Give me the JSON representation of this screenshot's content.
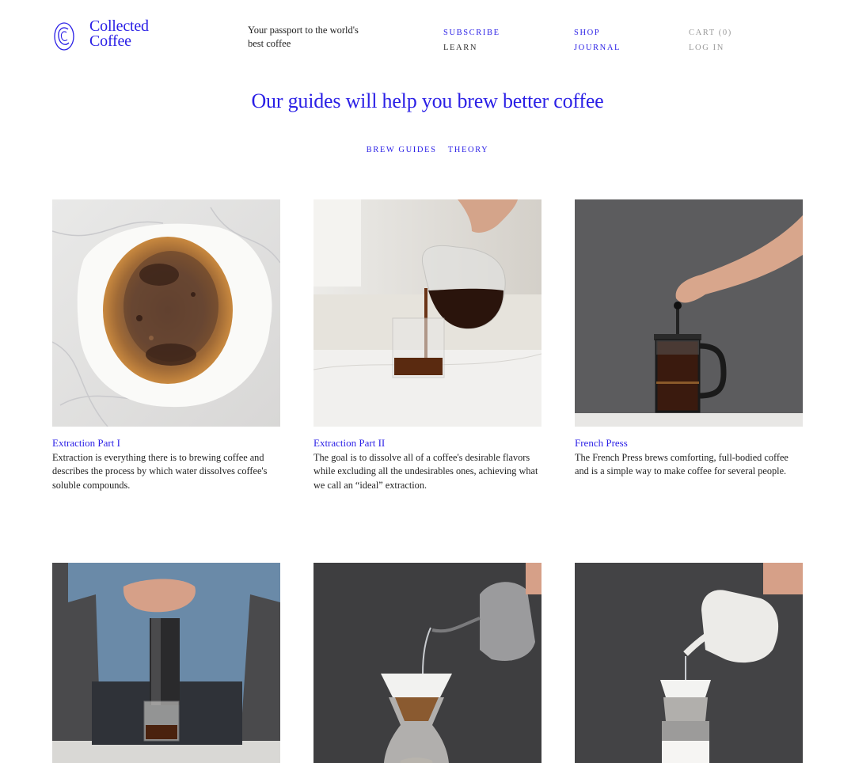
{
  "brand": {
    "name_line1": "Collected",
    "name_line2": "Coffee",
    "tagline": "Your passport to the world's best coffee"
  },
  "nav": {
    "subscribe": "SUBSCRIBE",
    "learn": "LEARN",
    "shop": "SHOP",
    "journal": "JOURNAL",
    "cart": "CART (0)",
    "login": "LOG IN"
  },
  "hero": {
    "title": "Our guides will help you brew better coffee"
  },
  "filters": [
    "BREW GUIDES",
    "THEORY"
  ],
  "guides": [
    {
      "title": "Extraction Part I",
      "description": "Extraction is everything there is to brewing coffee and describes the process by which water dissolves coffee's soluble compounds.",
      "image": "coffee-filter-grounds-photo"
    },
    {
      "title": "Extraction Part II",
      "description": "The goal is to dissolve all of a coffee's desirable flavors while excluding all the undesirables ones, achieving what we call an “ideal” extraction.",
      "image": "pouring-coffee-photo"
    },
    {
      "title": "French Press",
      "description": "The French Press brews comforting, full-bodied coffee and is a simple way to make coffee for several people.",
      "image": "french-press-photo"
    },
    {
      "title": "",
      "description": "",
      "image": "aeropress-photo"
    },
    {
      "title": "",
      "description": "",
      "image": "chemex-pour-photo"
    },
    {
      "title": "",
      "description": "",
      "image": "kalita-pour-photo"
    }
  ],
  "colors": {
    "accent": "#2a1fe6",
    "text": "#222222",
    "muted": "#9a9a9a"
  }
}
